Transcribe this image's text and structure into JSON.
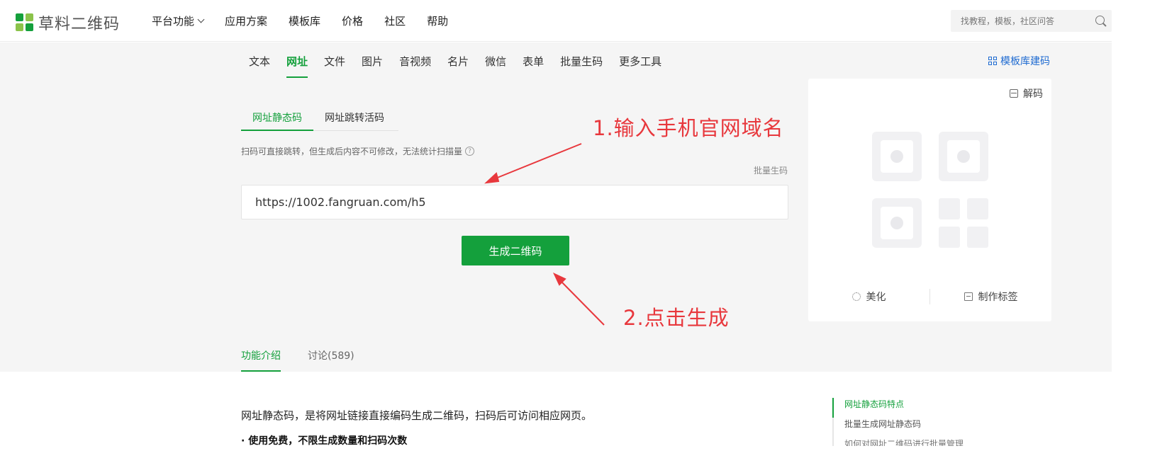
{
  "brand": {
    "logo_text": "草料二维码",
    "accent": "#14a03c",
    "annotation_color": "#e8383d"
  },
  "topnav": [
    {
      "label": "平台功能",
      "has_dropdown": true
    },
    {
      "label": "应用方案"
    },
    {
      "label": "模板库"
    },
    {
      "label": "价格"
    },
    {
      "label": "社区"
    },
    {
      "label": "帮助"
    }
  ],
  "search": {
    "placeholder": "找教程，模板，社区问答"
  },
  "type_tabs": [
    "文本",
    "网址",
    "文件",
    "图片",
    "音视频",
    "名片",
    "微信",
    "表单",
    "批量生码",
    "更多工具"
  ],
  "active_type_tab": "网址",
  "template_link": "模板库建码",
  "sub_tabs": [
    "网址静态码",
    "网址跳转活码"
  ],
  "hint": "扫码可直接跳转，但生成后内容不可修改，无法统计扫描量",
  "batch_link": "批量生码",
  "url_input": {
    "value": "https://1002.fangruan.com/h5"
  },
  "generate_button": "生成二维码",
  "annotations": {
    "step1": "1.输入手机官网域名",
    "step2": "2.点击生成"
  },
  "qr_panel": {
    "decode": "解码",
    "beautify": "美化",
    "make_label": "制作标签"
  },
  "bottom_tabs": [
    "功能介绍",
    "讨论(589)"
  ],
  "intro": "网址静态码，是将网址链接直接编码生成二维码，扫码后可访问相应网页。",
  "bullet": "· 使用免费，不限生成数量和扫码次数",
  "toc": [
    "网址静态码特点",
    "批量生成网址静态码",
    "如何对网址二维码进行批量管理"
  ]
}
